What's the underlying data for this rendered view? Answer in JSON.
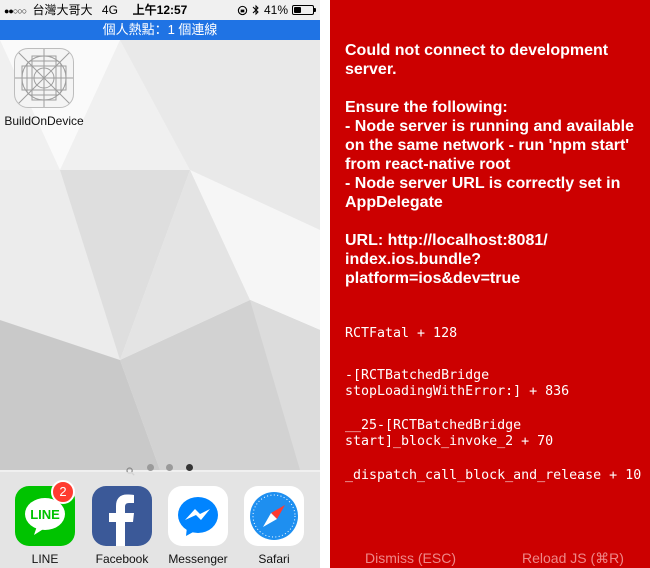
{
  "status_bar": {
    "signal": "●●○○○",
    "carrier": "台灣大哥大",
    "network": "4G",
    "time": "上午12:57",
    "lock_icon": "rotation-lock-icon",
    "bluetooth_icon": "bluetooth-icon",
    "battery": "41%",
    "battery_level": 0.41
  },
  "hotspot_bar": {
    "text": "個人熱點：1 個連線",
    "color": "#1f73e4"
  },
  "home_screen": {
    "apps": [
      {
        "name": "BuildOnDevice",
        "icon": "app-placeholder-icon"
      }
    ],
    "page_indicator": {
      "count": 4,
      "active": 4
    },
    "dock": [
      {
        "name": "LINE",
        "icon": "line-icon",
        "badge": "2",
        "color": "#00c300"
      },
      {
        "name": "Facebook",
        "icon": "facebook-icon",
        "color": "#3b5998"
      },
      {
        "name": "Messenger",
        "icon": "messenger-icon",
        "color": "#0084ff"
      },
      {
        "name": "Safari",
        "icon": "safari-icon",
        "color": "#1e90ff"
      }
    ]
  },
  "redbox": {
    "background": "#cc0000",
    "title": "Could not connect to development server.",
    "ensure_heading": "Ensure the following:",
    "bullets": [
      "- Node server is running and available on the same network - run 'npm start' from react-native root",
      "- Node server URL is correctly set in AppDelegate"
    ],
    "url_line": "URL: http://localhost:8081/ index.ios.bundle? platform=ios&dev=true",
    "stack": [
      "RCTFatal + 128",
      "-[RCTBatchedBridge stopLoadingWithError:] + 836",
      "__25-[RCTBatchedBridge start]_block_invoke_2 + 70",
      "_dispatch_call_block_and_release + 10"
    ],
    "dismiss_label": "Dismiss (ESC)",
    "reload_label": "Reload JS (⌘R)"
  }
}
